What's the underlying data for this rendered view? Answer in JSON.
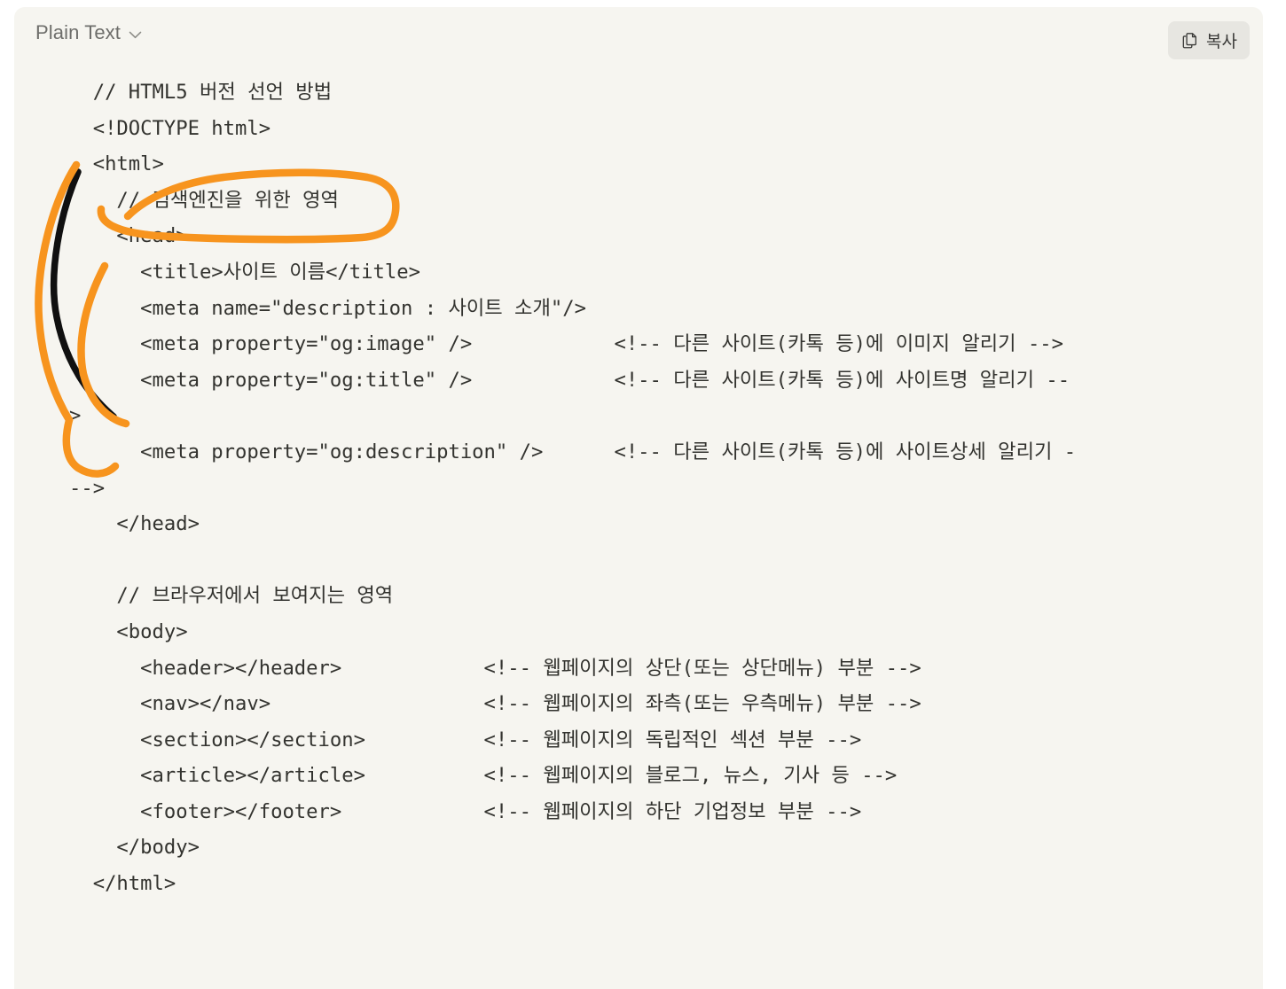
{
  "card": {
    "language_label": "Plain Text",
    "language_dropdown_icon": "chevron-down-icon",
    "copy_button_label": "복사",
    "copy_button_icon": "copy-icon"
  },
  "colors": {
    "page_background": "#ffffff",
    "card_background": "#F6F5F0",
    "code_text": "#33332F",
    "muted_text": "#6E6E6B",
    "copy_button_background": "#E7E6E1",
    "annotation_orange": "#F7941E",
    "annotation_black": "#101010"
  },
  "code": {
    "language": "Plain Text",
    "text": "  // HTML5 버전 선언 방법\n  <!DOCTYPE html>\n  <html>\n    // 검색엔진을 위한 영역\n    <head>\n      <title>사이트 이름</title>\n      <meta name=\"description : 사이트 소개\"/>\n      <meta property=\"og:image\" />            <!-- 다른 사이트(카톡 등)에 이미지 알리기 -->\n      <meta property=\"og:title\" />            <!-- 다른 사이트(카톡 등)에 사이트명 알리기 --\n>\n      <meta property=\"og:description\" />      <!-- 다른 사이트(카톡 등)에 사이트상세 알리기 -\n-->\n    </head>\n\n    // 브라우저에서 보여지는 영역\n    <body>\n      <header></header>            <!-- 웹페이지의 상단(또는 상단메뉴) 부분 -->\n      <nav></nav>                  <!-- 웹페이지의 좌측(또는 우측메뉴) 부분 -->\n      <section></section>          <!-- 웹페이지의 독립적인 섹션 부분 -->\n      <article></article>          <!-- 웹페이지의 블로그, 뉴스, 기사 등 -->\n      <footer></footer>            <!-- 웹페이지의 하단 기업정보 부분 -->\n    </body>\n  </html>",
    "lines": [
      "  // HTML5 버전 선언 방법",
      "  <!DOCTYPE html>",
      "  <html>",
      "    // 검색엔진을 위한 영역",
      "    <head>",
      "      <title>사이트 이름</title>",
      "      <meta name=\"description : 사이트 소개\"/>",
      "      <meta property=\"og:image\" />            <!-- 다른 사이트(카톡 등)에 이미지 알리기 -->",
      "      <meta property=\"og:title\" />            <!-- 다른 사이트(카톡 등)에 사이트명 알리기 --",
      ">",
      "      <meta property=\"og:description\" />      <!-- 다른 사이트(카톡 등)에 사이트상세 알리기 -",
      "-->",
      "    </head>",
      "",
      "    // 브라우저에서 보여지는 영역",
      "    <body>",
      "      <header></header>            <!-- 웹페이지의 상단(또는 상단메뉴) 부분 -->",
      "      <nav></nav>                  <!-- 웹페이지의 좌측(또는 우측메뉴) 부분 -->",
      "      <section></section>          <!-- 웹페이지의 독립적인 섹션 부분 -->",
      "      <article></article>          <!-- 웹페이지의 블로그, 뉴스, 기사 등 -->",
      "      <footer></footer>            <!-- 웹페이지의 하단 기업정보 부분 -->",
      "    </body>",
      "  </html>"
    ]
  },
  "annotations": [
    {
      "id": "head-section-circle",
      "kind": "hand-drawn-loop",
      "color": "#F7941E",
      "encircles": "// 검색엔진을 위한 영역 / <head>"
    },
    {
      "id": "head-brace-orange",
      "kind": "hand-drawn-brace",
      "color": "#F7941E",
      "spans": "head block from <html> down to -->"
    },
    {
      "id": "html-stroke-black",
      "kind": "hand-drawn-stroke",
      "color": "#101010",
      "spans": "from <html> curving down past og:title"
    }
  ]
}
